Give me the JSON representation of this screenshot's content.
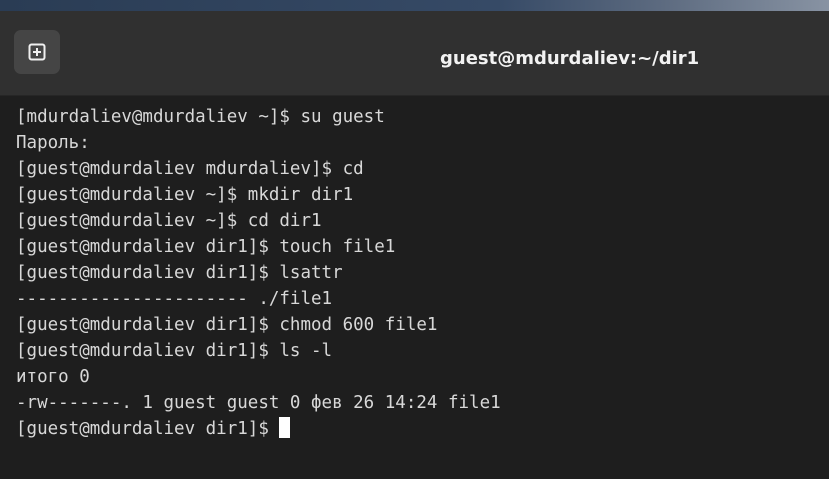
{
  "window": {
    "title": "guest@mdurdaliev:~/dir1",
    "new_tab_icon": "new-tab-icon"
  },
  "terminal": {
    "lines": [
      "[mdurdaliev@mdurdaliev ~]$ su guest",
      "Пароль:",
      "[guest@mdurdaliev mdurdaliev]$ cd",
      "[guest@mdurdaliev ~]$ mkdir dir1",
      "[guest@mdurdaliev ~]$ cd dir1",
      "[guest@mdurdaliev dir1]$ touch file1",
      "[guest@mdurdaliev dir1]$ lsattr",
      "---------------------- ./file1",
      "[guest@mdurdaliev dir1]$ chmod 600 file1",
      "[guest@mdurdaliev dir1]$ ls -l",
      "итого 0",
      "-rw-------. 1 guest guest 0 фев 26 14:24 file1"
    ],
    "prompt": "[guest@mdurdaliev dir1]$ "
  },
  "colors": {
    "background": "#1e1e1e",
    "titlebar": "#303030",
    "text": "#d8d8d8",
    "cursor": "#ffffff"
  }
}
